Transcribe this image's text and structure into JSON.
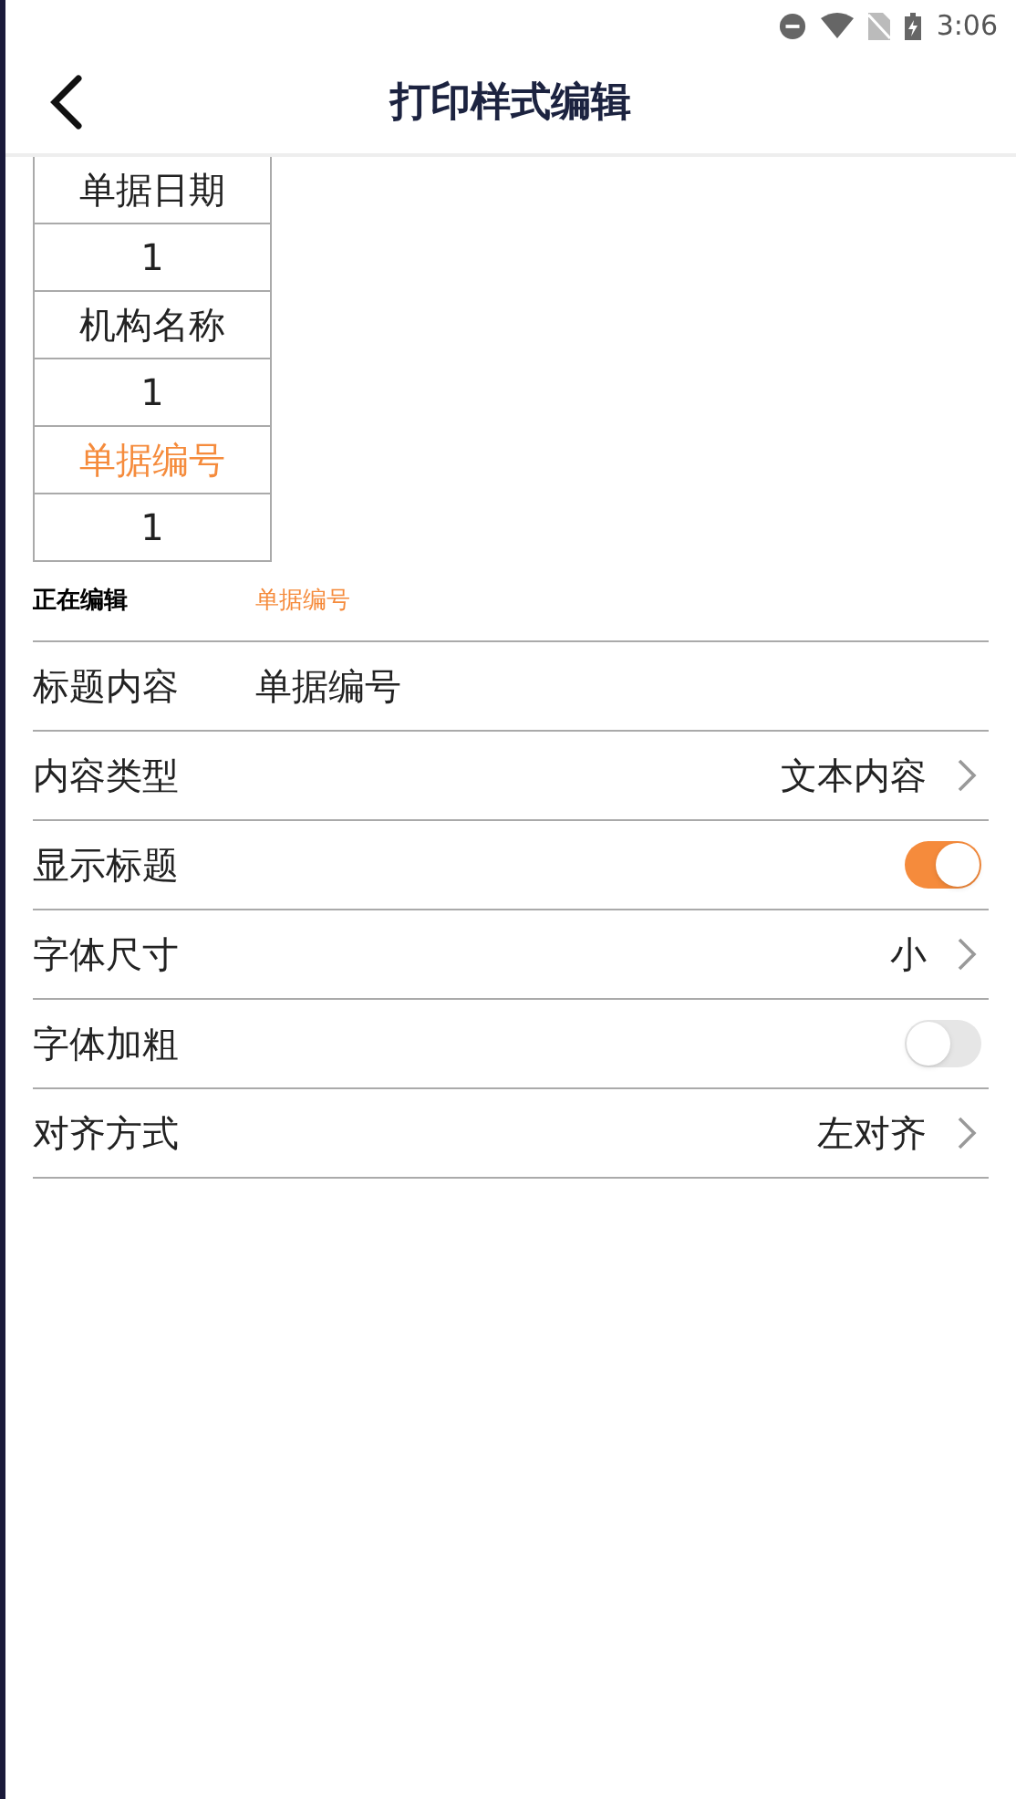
{
  "status_bar": {
    "time": "3:06"
  },
  "header": {
    "title": "打印样式编辑"
  },
  "preview": [
    {
      "title": "单据日期",
      "value": "1",
      "selected": false
    },
    {
      "title": "机构名称",
      "value": "1",
      "selected": false
    },
    {
      "title": "单据编号",
      "value": "1",
      "selected": true
    }
  ],
  "editing": {
    "label": "正在编辑",
    "value": "单据编号"
  },
  "settings": [
    {
      "kind": "text",
      "label": "标题内容",
      "value": "单据编号"
    },
    {
      "kind": "select",
      "label": "内容类型",
      "value": "文本内容"
    },
    {
      "kind": "toggle",
      "label": "显示标题",
      "on": true
    },
    {
      "kind": "select",
      "label": "字体尺寸",
      "value": "小"
    },
    {
      "kind": "toggle",
      "label": "字体加粗",
      "on": false
    },
    {
      "kind": "select",
      "label": "对齐方式",
      "value": "左对齐"
    }
  ]
}
